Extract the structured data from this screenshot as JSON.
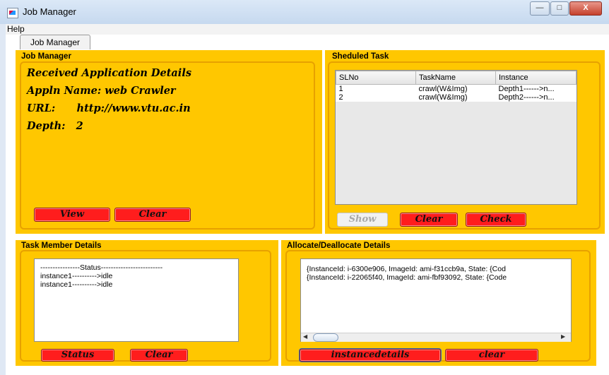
{
  "window": {
    "title": "Job Manager",
    "controls": {
      "minimize": "—",
      "maximize": "□",
      "close": "X"
    }
  },
  "menu": {
    "help": "Help"
  },
  "tab": {
    "label": "Job Manager"
  },
  "job_manager": {
    "title": "Job Manager",
    "lines": [
      "Received Application Details",
      "Appln Name:  web Crawler",
      "URL:      http://www.vtu.ac.in",
      "Depth:   2"
    ],
    "view_label": "View",
    "clear_label": "Clear"
  },
  "scheduled_task": {
    "title": "Sheduled Task",
    "columns": [
      "SLNo",
      "TaskName",
      "Instance"
    ],
    "rows": [
      [
        "1",
        "crawl(W&Img)",
        "Depth1------>n..."
      ],
      [
        "2",
        "crawl(W&Img)",
        "Depth2------>n..."
      ]
    ],
    "show_label": "Show",
    "clear_label": "Clear",
    "check_label": "Check"
  },
  "task_member": {
    "title": "Task Member Details",
    "lines": [
      "----------------Status-------------------------",
      "instance1---------->idle",
      "instance1---------->idle"
    ],
    "status_label": "Status",
    "clear_label": "Clear"
  },
  "allocate": {
    "title": "Allocate/Deallocate Details",
    "lines": [
      "{InstanceId: i-6300e906, ImageId: ami-f31ccb9a, State: {Cod",
      "{InstanceId: i-22065f40, ImageId: ami-fbf93092, State: {Code"
    ],
    "instancedetails_label": "instancedetails",
    "clear_label": "clear"
  },
  "colors": {
    "panel": "#ffc700",
    "button": "#ff1d1d",
    "border": "#e7a100"
  }
}
